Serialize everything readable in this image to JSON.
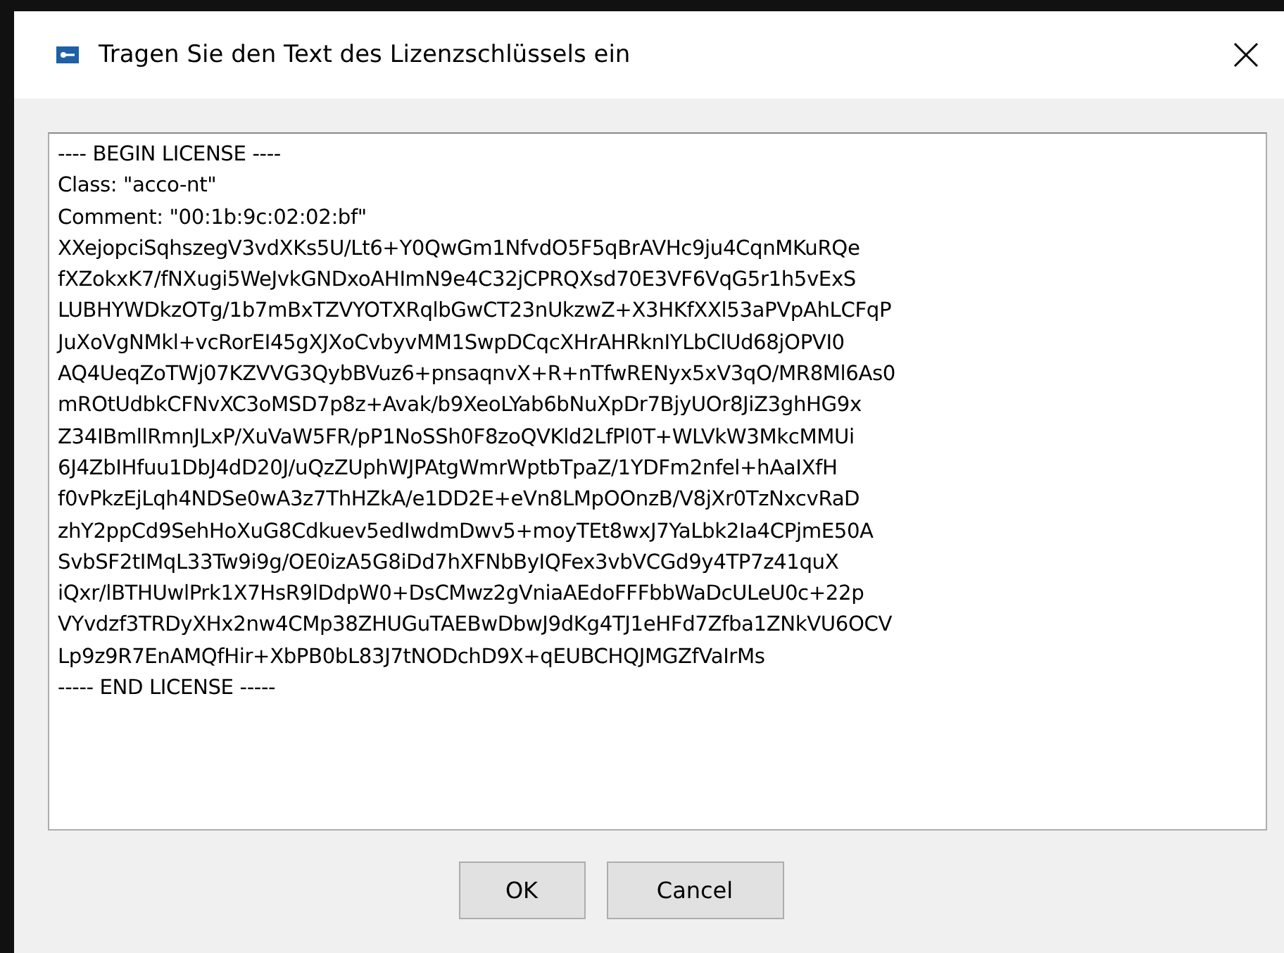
{
  "window": {
    "title": "Tragen Sie den Text des Lizenzschlüssels ein"
  },
  "license_field": {
    "lines": [
      "---- BEGIN LICENSE ----",
      "Class: \"acco-nt\"",
      "Comment: \"00:1b:9c:02:02:bf\"",
      "XXejopciSqhszegV3vdXKs5U/Lt6+Y0QwGm1NfvdO5F5qBrAVHc9ju4CqnMKuRQe",
      "fXZokxK7/fNXugi5WeJvkGNDxoAHImN9e4C32jCPRQXsd70E3VF6VqG5r1h5vExS",
      "LUBHYWDkzOTg/1b7mBxTZVYOTXRqlbGwCT23nUkzwZ+X3HKfXXl53aPVpAhLCFqP",
      "JuXoVgNMkl+vcRorEI45gXJXoCvbyvMM1SwpDCqcXHrAHRknIYLbClUd68jOPVI0",
      "AQ4UeqZoTWj07KZVVG3QybBVuz6+pnsaqnvX+R+nTfwRENyx5xV3qO/MR8Ml6As0",
      "mROtUdbkCFNvXC3oMSD7p8z+Avak/b9XeoLYab6bNuXpDr7BjyUOr8JiZ3ghHG9x",
      "Z34IBmllRmnJLxP/XuVaW5FR/pP1NoSSh0F8zoQVKld2LfPl0T+WLVkW3MkcMMUi",
      "6J4ZbIHfuu1DbJ4dD20J/uQzZUphWJPAtgWmrWptbTpaZ/1YDFm2nfel+hAaIXfH",
      "f0vPkzEjLqh4NDSe0wA3z7ThHZkA/e1DD2E+eVn8LMpOOnzB/V8jXr0TzNxcvRaD",
      "zhY2ppCd9SehHoXuG8Cdkuev5edIwdmDwv5+moyTEt8wxJ7YaLbk2Ia4CPjmE50A",
      "SvbSF2tIMqL33Tw9i9g/OE0izA5G8iDd7hXFNbByIQFex3vbVCGd9y4TP7z41quX",
      "iQxr/lBTHUwlPrk1X7HsR9lDdpW0+DsCMwz2gVniaAEdoFFFbbWaDcULeU0c+22p",
      "VYvdzf3TRDyXHx2nw4CMp38ZHUGuTAEBwDbwJ9dKg4TJ1eHFd7Zfba1ZNkVU6OCV",
      "Lp9z9R7EnAMQfHir+XbPB0bL83J7tNODchD9X+qEUBCHQJMGZfVaIrMs",
      "----- END LICENSE -----"
    ]
  },
  "buttons": [
    "OK",
    "Cancel"
  ]
}
